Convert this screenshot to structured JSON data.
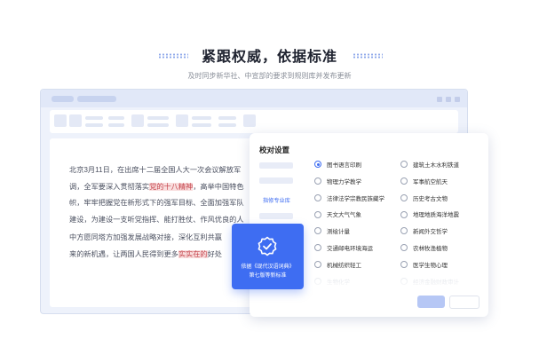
{
  "hero": {
    "title": "紧跟权威，依据标准",
    "subtitle": "及时同步新华社、中宣部的要求到规则库并发布更新"
  },
  "document": {
    "paragraph1": {
      "lines": [
        [
          "北京3月11日，在出席十二届全国人大一次会议解放军",
          ""
        ],
        [
          "调，全军要深入贯彻落实",
          "党的十八精神",
          "，高举中国特色"
        ],
        [
          "帜，牢牢把握党在新形式下的强军目标、全面加强军队",
          ""
        ],
        [
          "建设，为建设一支听党指挥、能打胜仗、作风优良的人",
          ""
        ]
      ]
    },
    "paragraph2": {
      "line1": "中方愿同塔方加强发展战略对接，深化互利共赢",
      "line2_pre": "来的新机遇，让两国人民得到更多",
      "line2_hl": "实实在的",
      "line2_post": "好处"
    }
  },
  "badge": {
    "icon": "verified-shield-icon",
    "line1": "依据《现代汉语词典》",
    "line2": "第七版等新标准"
  },
  "panel": {
    "title": "校对设置",
    "sidebar_selected": "指修专业库",
    "options_left": [
      {
        "label": "图书语言印刷",
        "selected": true
      },
      {
        "label": "物理力学教学",
        "selected": false
      },
      {
        "label": "法律法学宗教民族藏学",
        "selected": false
      },
      {
        "label": "天文大气气象",
        "selected": false
      },
      {
        "label": "测绘计量",
        "selected": false
      },
      {
        "label": "交通邮电环境海运",
        "selected": false
      },
      {
        "label": "机械纺织轻工",
        "selected": false
      },
      {
        "label": "生物化学",
        "selected": false
      }
    ],
    "options_right": [
      {
        "label": "建筑土木水利铁道",
        "selected": false
      },
      {
        "label": "军事航空航天",
        "selected": false
      },
      {
        "label": "历史考古文物",
        "selected": false
      },
      {
        "label": "地理地质海洋地震",
        "selected": false
      },
      {
        "label": "新闻外交哲学",
        "selected": false
      },
      {
        "label": "农林牧渔植物",
        "selected": false
      },
      {
        "label": "医学生物心理",
        "selected": false
      },
      {
        "label": "经济金融财政审计",
        "selected": false
      }
    ]
  },
  "colors": {
    "accent": "#3e6df2",
    "highlight_bg": "#f9dede",
    "highlight_text": "#c4424a"
  }
}
